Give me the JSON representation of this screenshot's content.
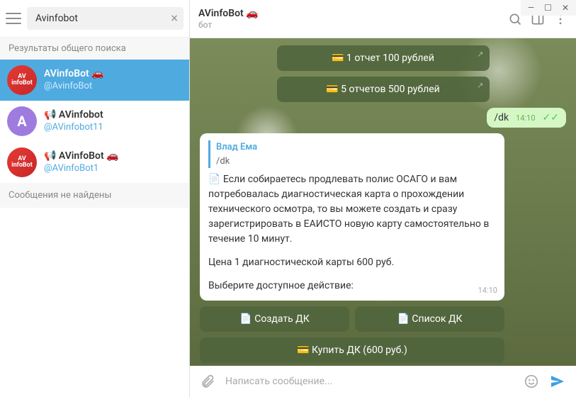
{
  "search": {
    "value": "Avinfobot"
  },
  "sections": {
    "global_results": "Результаты общего поиска",
    "no_messages": "Сообщения не найдены"
  },
  "results": [
    {
      "title": "AVinfoBot 🚗",
      "sub": "@AvinfoBot",
      "avatar": "AV\ninfoBot",
      "avatarClass": "avatar-red"
    },
    {
      "title": "📢 AVinfobot",
      "sub": "@AVinfobot11",
      "avatar": "A",
      "avatarClass": "avatar-purple"
    },
    {
      "title": "📢 AVinfoBot 🚗",
      "sub": "@AVinfoBot1",
      "avatar": "AV\ninfoBot",
      "avatarClass": "avatar-red"
    }
  ],
  "chat": {
    "title": "AVinfoBot 🚗",
    "sub": "бот",
    "buttons_top": [
      "💳 1 отчет 100 рублей",
      "💳 5 отчетов 500 рублей"
    ],
    "out_msg": {
      "text": "/dk",
      "time": "14:10"
    },
    "bot_msg": {
      "reply_name": "Влад Ема",
      "reply_text": "/dk",
      "body1": "📄 Если собираетесь продлевать полис ОСАГО и вам потребовалась диагностическая карта о прохождении технического осмотра, то вы можете создать и сразу зарегистрировать в ЕАИСТО новую карту самостоятельно в течение 10 минут.",
      "body2": "Цена 1 диагностической карты 600 руб.",
      "body3": "Выберите доступное действие:",
      "time": "14:10"
    },
    "buttons_bottom_row": [
      "📄 Создать ДК",
      "📄 Список ДК"
    ],
    "buttons_bottom_single": "💳 Купить ДК (600 руб.)"
  },
  "composer": {
    "placeholder": "Написать сообщение..."
  }
}
